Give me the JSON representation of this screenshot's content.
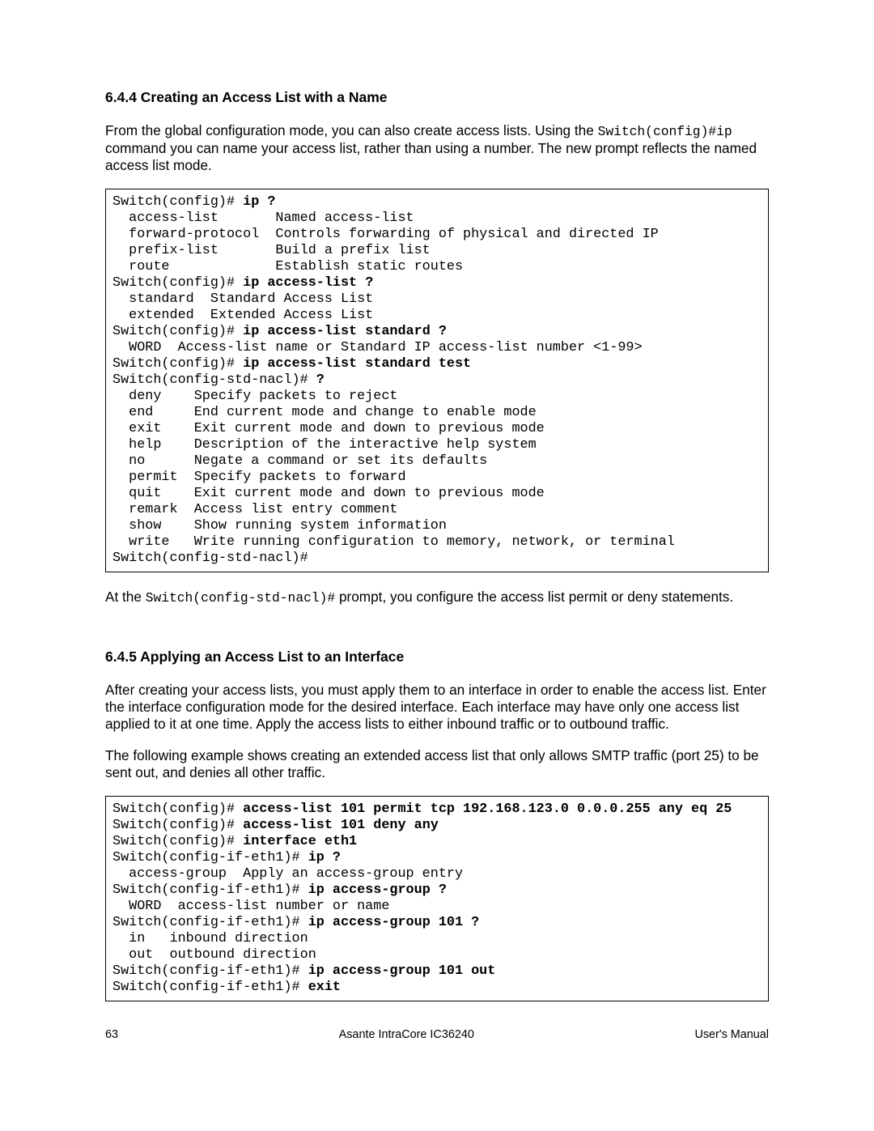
{
  "section1": {
    "heading": "6.4.4 Creating an Access List with a Name",
    "para1_a": "From the global configuration mode, you can also create access lists. Using the ",
    "para1_code": "Switch(config)#ip",
    "para1_b": " command you can name your access list, rather than using a number. The new prompt reflects the named access list mode."
  },
  "code1": {
    "l01a": "Switch(config)# ",
    "l01b": "ip ?",
    "l02": "  access-list       Named access-list",
    "l03": "  forward-protocol  Controls forwarding of physical and directed IP",
    "l04": "  prefix-list       Build a prefix list",
    "l05": "  route             Establish static routes",
    "l06a": "Switch(config)# ",
    "l06b": "ip access-list ?",
    "l07": "  standard  Standard Access List",
    "l08": "  extended  Extended Access List",
    "l09a": "Switch(config)# ",
    "l09b": "ip access-list standard ?",
    "l10": "  WORD  Access-list name or Standard IP access-list number <1-99>",
    "l11a": "Switch(config)# ",
    "l11b": "ip access-list standard test",
    "l12a": "Switch(config-std-nacl)# ",
    "l12b": "?",
    "l13": "  deny    Specify packets to reject",
    "l14": "  end     End current mode and change to enable mode",
    "l15": "  exit    Exit current mode and down to previous mode",
    "l16": "  help    Description of the interactive help system",
    "l17": "  no      Negate a command or set its defaults",
    "l18": "  permit  Specify packets to forward",
    "l19": "  quit    Exit current mode and down to previous mode",
    "l20": "  remark  Access list entry comment",
    "l21": "  show    Show running system information",
    "l22": "  write   Write running configuration to memory, network, or terminal",
    "l23": "Switch(config-std-nacl)#"
  },
  "section1_tail": {
    "a": "At the ",
    "code": "Switch(config-std-nacl)#",
    "b": " prompt, you configure the access list permit or deny statements."
  },
  "section2": {
    "heading": "6.4.5 Applying an Access List to an Interface",
    "para1": "After creating your access lists, you must apply them to an interface in order to enable the access list. Enter the interface configuration mode for the desired interface. Each interface may have only one access list applied to it at one time. Apply the access lists to either inbound traffic or to outbound traffic.",
    "para2": "The following example shows creating an extended access list that only allows SMTP traffic (port 25) to be sent out, and denies all other traffic."
  },
  "code2": {
    "l01a": "Switch(config)# ",
    "l01b": "access-list 101 permit tcp 192.168.123.0 0.0.0.255 any eq 25",
    "l02a": "Switch(config)# ",
    "l02b": "access-list 101 deny any",
    "l03a": "Switch(config)# ",
    "l03b": "interface eth1",
    "l04a": "Switch(config-if-eth1)# ",
    "l04b": "ip ?",
    "l05": "  access-group  Apply an access-group entry",
    "l06a": "Switch(config-if-eth1)# ",
    "l06b": "ip access-group ?",
    "l07": "  WORD  access-list number or name",
    "l08a": "Switch(config-if-eth1)# ",
    "l08b": "ip access-group 101 ?",
    "l09": "  in   inbound direction",
    "l10": "  out  outbound direction",
    "l11a": "Switch(config-if-eth1)# ",
    "l11b": "ip access-group 101 out",
    "l12a": "Switch(config-if-eth1)# ",
    "l12b": "exit"
  },
  "footer": {
    "page": "63",
    "title": "Asante IntraCore IC36240",
    "right": "User's Manual"
  }
}
